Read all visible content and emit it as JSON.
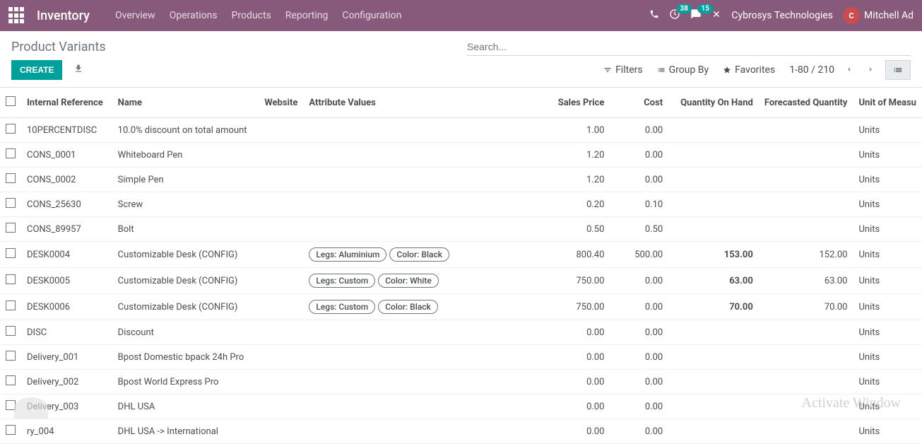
{
  "navbar": {
    "title": "Inventory",
    "menu": [
      "Overview",
      "Operations",
      "Products",
      "Reporting",
      "Configuration"
    ],
    "badge_clock": "38",
    "badge_chat": "15",
    "company": "Cybrosys Technologies",
    "user": "Mitchell Ad"
  },
  "breadcrumb": "Product Variants",
  "search_placeholder": "Search...",
  "buttons": {
    "create": "CREATE",
    "filters": "Filters",
    "groupby": "Group By",
    "favorites": "Favorites"
  },
  "pager": "1-80 / 210",
  "columns": {
    "ref": "Internal Reference",
    "name": "Name",
    "website": "Website",
    "attrs": "Attribute Values",
    "sales": "Sales Price",
    "cost": "Cost",
    "qoh": "Quantity On Hand",
    "forecast": "Forecasted Quantity",
    "uom": "Unit of Measu"
  },
  "rows": [
    {
      "ref": "10PERCENTDISC",
      "name": "10.0% discount on total amount",
      "attrs": [],
      "sales": "1.00",
      "cost": "0.00",
      "qoh": "",
      "forecast": "",
      "uom": "Units"
    },
    {
      "ref": "CONS_0001",
      "name": "Whiteboard Pen",
      "attrs": [],
      "sales": "1.20",
      "cost": "0.00",
      "qoh": "",
      "forecast": "",
      "uom": "Units"
    },
    {
      "ref": "CONS_0002",
      "name": "Simple Pen",
      "attrs": [],
      "sales": "1.20",
      "cost": "0.00",
      "qoh": "",
      "forecast": "",
      "uom": "Units"
    },
    {
      "ref": "CONS_25630",
      "name": "Screw",
      "attrs": [],
      "sales": "0.20",
      "cost": "0.10",
      "qoh": "",
      "forecast": "",
      "uom": "Units"
    },
    {
      "ref": "CONS_89957",
      "name": "Bolt",
      "attrs": [],
      "sales": "0.50",
      "cost": "0.50",
      "qoh": "",
      "forecast": "",
      "uom": "Units"
    },
    {
      "ref": "DESK0004",
      "name": "Customizable Desk (CONFIG)",
      "attrs": [
        "Legs: Aluminium",
        "Color: Black"
      ],
      "sales": "800.40",
      "cost": "500.00",
      "qoh": "153.00",
      "forecast": "152.00",
      "uom": "Units"
    },
    {
      "ref": "DESK0005",
      "name": "Customizable Desk (CONFIG)",
      "attrs": [
        "Legs: Custom",
        "Color: White"
      ],
      "sales": "750.00",
      "cost": "0.00",
      "qoh": "63.00",
      "forecast": "63.00",
      "uom": "Units"
    },
    {
      "ref": "DESK0006",
      "name": "Customizable Desk (CONFIG)",
      "attrs": [
        "Legs: Custom",
        "Color: Black"
      ],
      "sales": "750.00",
      "cost": "0.00",
      "qoh": "70.00",
      "forecast": "70.00",
      "uom": "Units"
    },
    {
      "ref": "DISC",
      "name": "Discount",
      "attrs": [],
      "sales": "0.00",
      "cost": "0.00",
      "qoh": "",
      "forecast": "",
      "uom": "Units"
    },
    {
      "ref": "Delivery_001",
      "name": "Bpost Domestic bpack 24h Pro",
      "attrs": [],
      "sales": "0.00",
      "cost": "0.00",
      "qoh": "",
      "forecast": "",
      "uom": "Units"
    },
    {
      "ref": "Delivery_002",
      "name": "Bpost World Express Pro",
      "attrs": [],
      "sales": "0.00",
      "cost": "0.00",
      "qoh": "",
      "forecast": "",
      "uom": "Units"
    },
    {
      "ref": "Delivery_003",
      "name": "DHL USA",
      "attrs": [],
      "sales": "0.00",
      "cost": "0.00",
      "qoh": "",
      "forecast": "",
      "uom": "Units"
    },
    {
      "ref": "ry_004",
      "name": "DHL USA -> International",
      "attrs": [],
      "sales": "0.00",
      "cost": "0.00",
      "qoh": "",
      "forecast": "",
      "uom": "Units"
    }
  ],
  "watermark": "Activate Window"
}
